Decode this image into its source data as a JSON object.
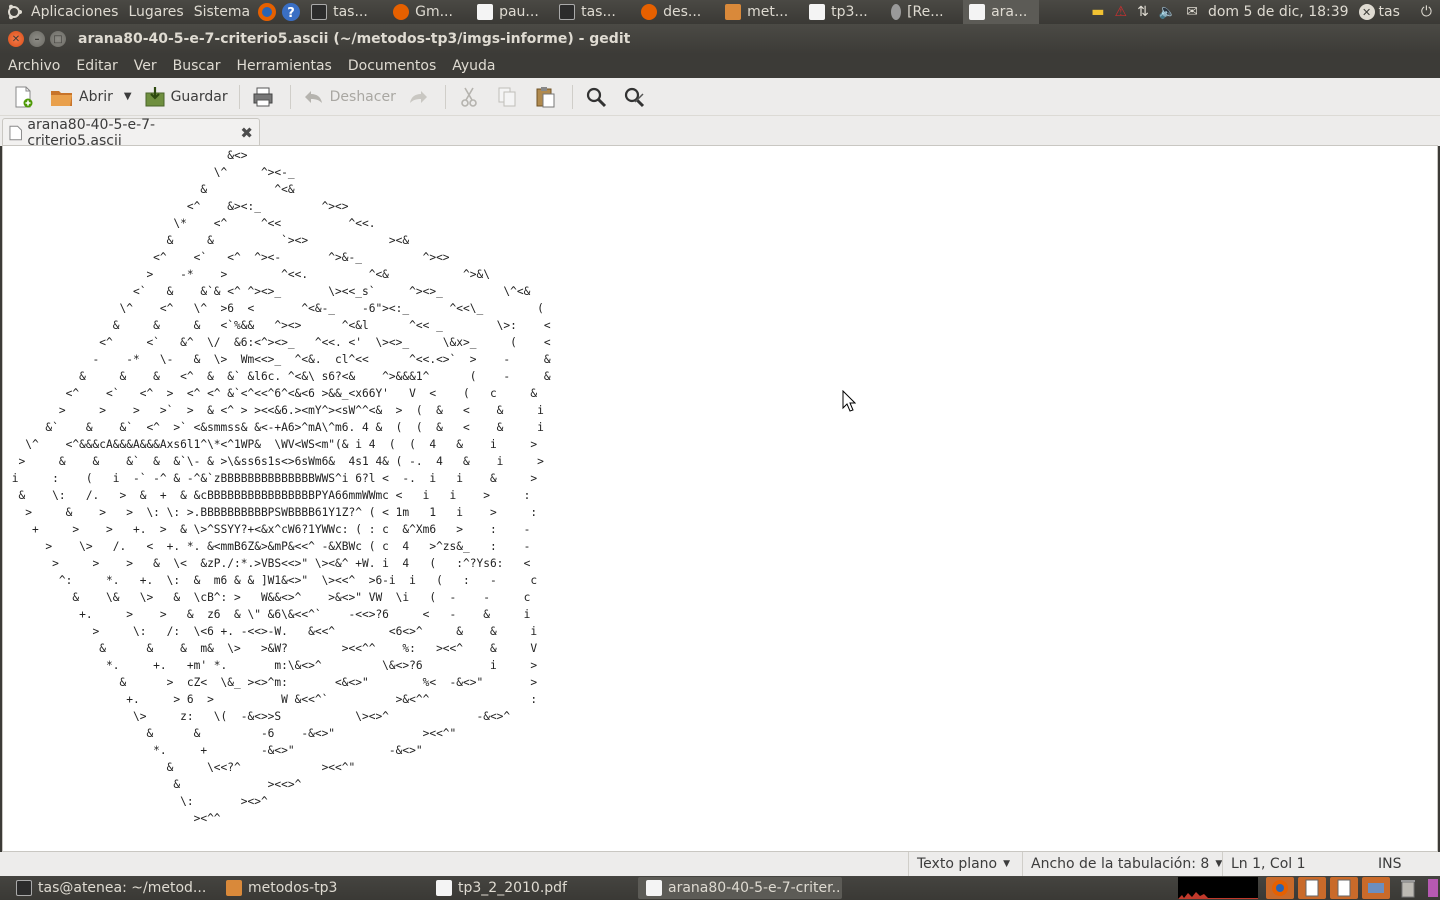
{
  "top_panel": {
    "menus": [
      "Aplicaciones",
      "Lugares",
      "Sistema"
    ],
    "tasks": [
      {
        "label": "tas...",
        "icon": "terminal-icon"
      },
      {
        "label": "Gm...",
        "icon": "firefox-icon"
      },
      {
        "label": "pau...",
        "icon": "document-icon"
      },
      {
        "label": "tas...",
        "icon": "terminal-icon"
      },
      {
        "label": "des...",
        "icon": "firefox-icon"
      },
      {
        "label": "met...",
        "icon": "folder-icon"
      },
      {
        "label": "tp3...",
        "icon": "document-icon"
      },
      {
        "label": "[Re...",
        "icon": "chat-icon"
      },
      {
        "label": "ara...",
        "icon": "text-editor-icon"
      }
    ],
    "clock": "dom  5 de dic, 18:39",
    "user": "tas"
  },
  "window": {
    "title": "arana80-40-5-e-7-criterio5.ascii (~/metodos-tp3/imgs-informe) - gedit"
  },
  "menubar": [
    "Archivo",
    "Editar",
    "Ver",
    "Buscar",
    "Herramientas",
    "Documentos",
    "Ayuda"
  ],
  "toolbar": {
    "open_label": "Abrir",
    "save_label": "Guardar",
    "undo_label": "Deshacer"
  },
  "tab": {
    "filename": "arana80-40-5-e-7-criterio5.ascii"
  },
  "editor": {
    "content": "                                 &<>\n                               \\^     ^><-_\n                             &          ^<&\n                           <^    &><:_         ^><>\n                         \\*    <^     ^<<          ^<<.\n                        &     &          `><>            ><&\n                      <^    <`   <^  ^><-       ^>&-_         ^><>\n                     >    -*    >        ^<<.         ^<&           ^>&\\\n                   <`   &    &`& <^ ^><>_       \\><<_s`     ^><>_         \\^<&\n                 \\^    <^   \\^  >6  <       ^<&-_    -6\"><:_      ^<<\\_        (\n                &     &     &   <`%&&   ^><>      ^<&l      ^<< _        \\>:    <\n              <^     <`   &^  \\/  &6:<^><>_   ^<<. <'  \\><>_     \\&x>_     (    <\n             -    -*   \\-   &  \\>  Wm<<>_  ^<&.  cl^<<      ^<<.<>`  >    -     &\n           &     &    &   <^  &  &` &l6c. ^<&\\ s6?<&    ^>&&&1^      (    -     &\n         <^    <`   <^  >  <^ <^ &`<^<<^6^<&<6 >&&_<x66Y'   V  <    (   c     &\n        >     >    >   >`  >  & <^ > ><<&6.><mY^><sW^^<&  >  (  &   <    &     i\n      &`    &    &`  <^  >` <&smmss& &<-+A6>^mA\\^m6. 4 &  (  (  &   <    &     i\n   \\^    <^&&&cA&&&A&&&Axs6l1^\\*<^1WP&  \\WV<WS<m\"(& i 4  (  (  4   &    i     >\n  >     &    &    &`  &  &`\\- & >\\&ss6s1s<>6sWm6&  4s1 4& ( -.  4   &    i     >\n i     :    (   i  -` -^ & -^&`zBBBBBBBBBBBBBBWWS^i 6?l <  -.  i   i    &     >\n  &    \\:   /.   >  &  +  & &cBBBBBBBBBBBBBBBBPYA66mmWWmc <   i   i    >     :\n   >     &    >   >  \\: \\: >.BBBBBBBBBBPSWBBBB61Y1Z?^ ( < 1m   1   i    >     :\n    +     >    >   +.  >  & \\>^SSYY?+<&x^cW6?1YWWc: ( : c  &^Xm6   >    :    -\n      >    \\>   /.   <  +. *. &<mmB6Z&>&mP&<<^ -&XBWc ( c  4   >^zs&_   :    -\n       >     >    >   &  \\<  &zP./:*.>VBS<<>\" \\><&^ +W. i  4   (   :^?Ys6:   <\n        ^:     *.   +.  \\:  &  m6 & & ]W1&<>\"  \\><<^  >6-i  i   (   :   -     c\n          &    \\&   \\>   &  \\cB^: >   W&&<>^    >&<>\" VW  \\i   (  -    -     c\n           +.     >    >   &  z6  & \\\" &6\\&<<^`    -<<>?6     <   -    &     i\n             >     \\:   /:  \\<6 +. -<<>-W.   &<<^        <6<>^     &    &     i\n              &      &    &  m&  \\>   >&W?        ><<^^    %:   ><<^    &     V\n               *.     +.   +m' *.       m:\\&<>^         \\&<>?6          i     >\n                 &      >  cZ<  \\&_ ><>^m:       <&<>\"        %<  -&<>\"       >\n                  +.     > 6  >          W &<<^`          >&<^^               :\n                   \\>     z:   \\(  -&<>>S           \\><>^             -&<>^\n                     &      &         -6    -&<>\"             ><<^\"\n                      *.     +        -&<>\"              -&<>\"\n                        &     \\<<?^            ><<^\"\n                         &             ><<>^\n                          \\:       ><>^\n                            ><^^"
  },
  "statusbar": {
    "syntax": "Texto plano",
    "tab_width": "Ancho de la tabulación: 8",
    "position": "Ln 1, Col 1",
    "mode": "INS"
  },
  "bottom_panel": {
    "tasks": [
      {
        "label": "tas@atenea: ~/metod...",
        "icon": "terminal-icon"
      },
      {
        "label": "metodos-tp3",
        "icon": "folder-icon"
      },
      {
        "label": "tp3_2_2010.pdf",
        "icon": "document-icon"
      },
      {
        "label": "arana80-40-5-e-7-criter...",
        "icon": "text-editor-icon"
      }
    ]
  },
  "colors": {
    "panel_bg": "#3c3b37",
    "toolbar_bg": "#edeceb",
    "close_button": "#e8561e",
    "editor_bg": "#ffffff"
  }
}
